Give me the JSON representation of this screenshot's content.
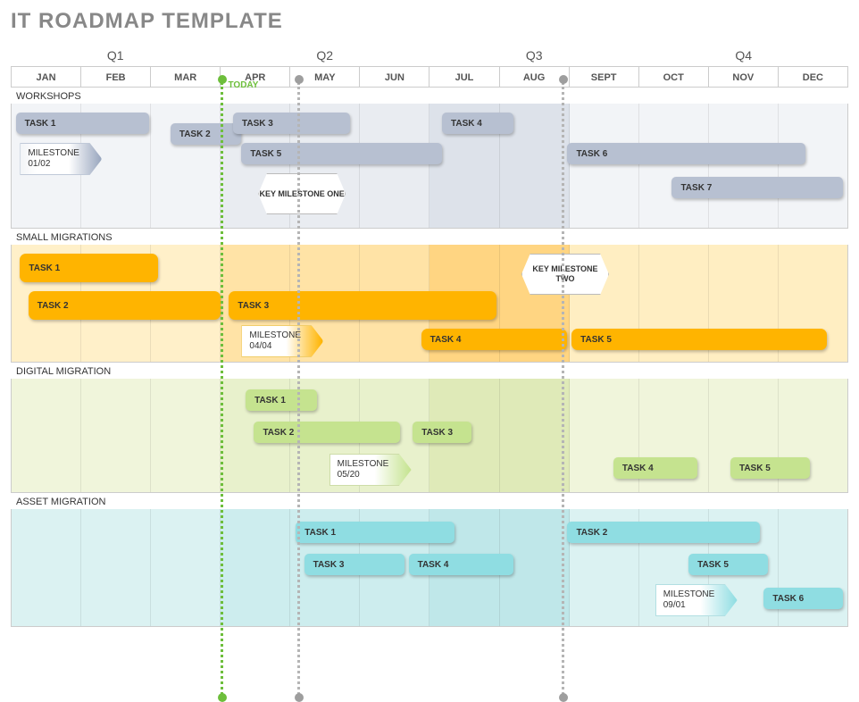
{
  "title": "IT ROADMAP TEMPLATE",
  "today_label": "TODAY",
  "quarters": [
    "Q1",
    "Q2",
    "Q3",
    "Q4"
  ],
  "months": [
    "JAN",
    "FEB",
    "MAR",
    "APR",
    "MAY",
    "JUN",
    "JUL",
    "AUG",
    "SEPT",
    "OCT",
    "NOV",
    "DEC"
  ],
  "sections": {
    "workshops": "WORKSHOPS",
    "small": "SMALL MIGRATIONS",
    "digital": "DIGITAL MIGRATION",
    "asset": "ASSET MIGRATION"
  },
  "key_milestones": {
    "one": "KEY\nMILESTONE\nONE",
    "two": "KEY\nMILESTONE\nTWO"
  },
  "milestones": {
    "workshops": {
      "label": "MILESTONE",
      "date": "01/02"
    },
    "small": {
      "label": "MILESTONE",
      "date": "04/04"
    },
    "digital": {
      "label": "MILESTONE",
      "date": "05/20"
    },
    "asset": {
      "label": "MILESTONE",
      "date": "09/01"
    }
  },
  "tasks": {
    "workshops": {
      "t1": "TASK 1",
      "t2": "TASK 2",
      "t3": "TASK 3",
      "t4": "TASK 4",
      "t5": "TASK 5",
      "t6": "TASK 6",
      "t7": "TASK 7"
    },
    "small": {
      "t1": "TASK 1",
      "t2": "TASK 2",
      "t3": "TASK 3",
      "t4": "TASK 4",
      "t5": "TASK 5"
    },
    "digital": {
      "t1": "TASK 1",
      "t2": "TASK 2",
      "t3": "TASK 3",
      "t4": "TASK 4",
      "t5": "TASK 5"
    },
    "asset": {
      "t1": "TASK 1",
      "t2": "TASK 2",
      "t3": "TASK 3",
      "t4": "TASK 4",
      "t5": "TASK 5",
      "t6": "TASK 6"
    }
  },
  "chart_data": {
    "type": "gantt",
    "timeline_months": [
      "JAN",
      "FEB",
      "MAR",
      "APR",
      "MAY",
      "JUN",
      "JUL",
      "AUG",
      "SEPT",
      "OCT",
      "NOV",
      "DEC"
    ],
    "today_month": 3.0,
    "markers": [
      {
        "type": "today",
        "month": 3.0,
        "color": "#6dbe3b"
      },
      {
        "type": "line",
        "month": 4.1,
        "color": "#b5b5b5"
      },
      {
        "type": "line",
        "month": 7.9,
        "color": "#b5b5b5"
      }
    ],
    "swimlanes": [
      {
        "name": "WORKSHOPS",
        "color": "#b7c0d1",
        "tasks": [
          {
            "name": "TASK 1",
            "start": 0.0,
            "end": 2.0,
            "row": 0
          },
          {
            "name": "TASK 2",
            "start": 2.3,
            "end": 3.3,
            "row": 0
          },
          {
            "name": "TASK 3",
            "start": 3.2,
            "end": 4.9,
            "row": 0
          },
          {
            "name": "TASK 4",
            "start": 6.2,
            "end": 7.2,
            "row": 0
          },
          {
            "name": "TASK 5",
            "start": 3.3,
            "end": 6.2,
            "row": 1
          },
          {
            "name": "TASK 6",
            "start": 8.0,
            "end": 11.4,
            "row": 1
          },
          {
            "name": "TASK 7",
            "start": 9.5,
            "end": 12.0,
            "row": 2
          }
        ],
        "milestones": [
          {
            "name": "MILESTONE 01/02",
            "month": 0.1,
            "row": 1
          },
          {
            "name": "KEY MILESTONE ONE",
            "month": 4.1,
            "row": 2,
            "key": true
          }
        ]
      },
      {
        "name": "SMALL MIGRATIONS",
        "color": "#ffb400",
        "tasks": [
          {
            "name": "TASK 1",
            "start": 0.1,
            "end": 2.1,
            "row": 0
          },
          {
            "name": "TASK 2",
            "start": 0.2,
            "end": 3.0,
            "row": 1
          },
          {
            "name": "TASK 3",
            "start": 3.1,
            "end": 7.0,
            "row": 1
          },
          {
            "name": "TASK 4",
            "start": 5.9,
            "end": 8.0,
            "row": 2
          },
          {
            "name": "TASK 5",
            "start": 8.0,
            "end": 11.7,
            "row": 2
          }
        ],
        "milestones": [
          {
            "name": "MILESTONE 04/04",
            "month": 3.3,
            "row": 2
          },
          {
            "name": "KEY MILESTONE TWO",
            "month": 7.9,
            "row": 0,
            "key": true
          }
        ]
      },
      {
        "name": "DIGITAL MIGRATION",
        "color": "#c5e38f",
        "tasks": [
          {
            "name": "TASK 1",
            "start": 3.4,
            "end": 4.4,
            "row": 0
          },
          {
            "name": "TASK 2",
            "start": 3.5,
            "end": 5.6,
            "row": 1
          },
          {
            "name": "TASK 3",
            "start": 5.8,
            "end": 6.6,
            "row": 1
          },
          {
            "name": "TASK 4",
            "start": 8.7,
            "end": 9.9,
            "row": 2
          },
          {
            "name": "TASK 5",
            "start": 10.3,
            "end": 11.4,
            "row": 2
          }
        ],
        "milestones": [
          {
            "name": "MILESTONE 05/20",
            "month": 4.6,
            "row": 2
          }
        ]
      },
      {
        "name": "ASSET MIGRATION",
        "color": "#8fdde2",
        "tasks": [
          {
            "name": "TASK 1",
            "start": 4.1,
            "end": 6.4,
            "row": 0
          },
          {
            "name": "TASK 2",
            "start": 8.0,
            "end": 10.8,
            "row": 0
          },
          {
            "name": "TASK 3",
            "start": 4.2,
            "end": 5.6,
            "row": 1
          },
          {
            "name": "TASK 4",
            "start": 5.7,
            "end": 7.2,
            "row": 1
          },
          {
            "name": "TASK 5",
            "start": 9.7,
            "end": 10.8,
            "row": 1
          },
          {
            "name": "TASK 6",
            "start": 10.8,
            "end": 12.0,
            "row": 2
          }
        ],
        "milestones": [
          {
            "name": "MILESTONE 09/01",
            "month": 9.2,
            "row": 2
          }
        ]
      }
    ]
  }
}
